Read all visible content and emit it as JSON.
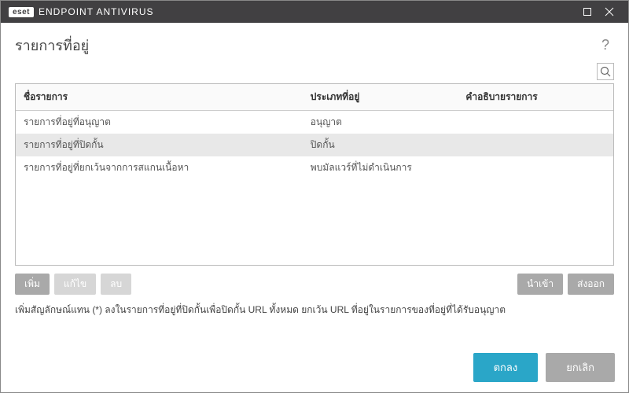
{
  "titlebar": {
    "brand": "eset",
    "product": "ENDPOINT ANTIVIRUS"
  },
  "page": {
    "title": "รายการที่อยู่"
  },
  "table": {
    "headers": {
      "name": "ชื่อรายการ",
      "type": "ประเภทที่อยู่",
      "desc": "คำอธิบายรายการ"
    },
    "rows": [
      {
        "name": "รายการที่อยู่ที่อนุญาต",
        "type": "อนุญาต",
        "desc": ""
      },
      {
        "name": "รายการที่อยู่ที่ปิดกั้น",
        "type": "ปิดกั้น",
        "desc": ""
      },
      {
        "name": "รายการที่อยู่ที่ยกเว้นจากการสแกนเนื้อหา",
        "type": "พบมัลแวร์ที่ไม่ดำเนินการ",
        "desc": ""
      }
    ]
  },
  "actions": {
    "add": "เพิ่ม",
    "edit": "แก้ไข",
    "delete": "ลบ",
    "import": "นำเข้า",
    "export": "ส่งออก"
  },
  "hint": "เพิ่มสัญลักษณ์แทน (*) ลงในรายการที่อยู่ที่ปิดกั้นเพื่อปิดกั้น URL ทั้งหมด ยกเว้น URL ที่อยู่ในรายการของที่อยู่ที่ได้รับอนุญาต",
  "footer": {
    "ok": "ตกลง",
    "cancel": "ยกเลิก"
  }
}
